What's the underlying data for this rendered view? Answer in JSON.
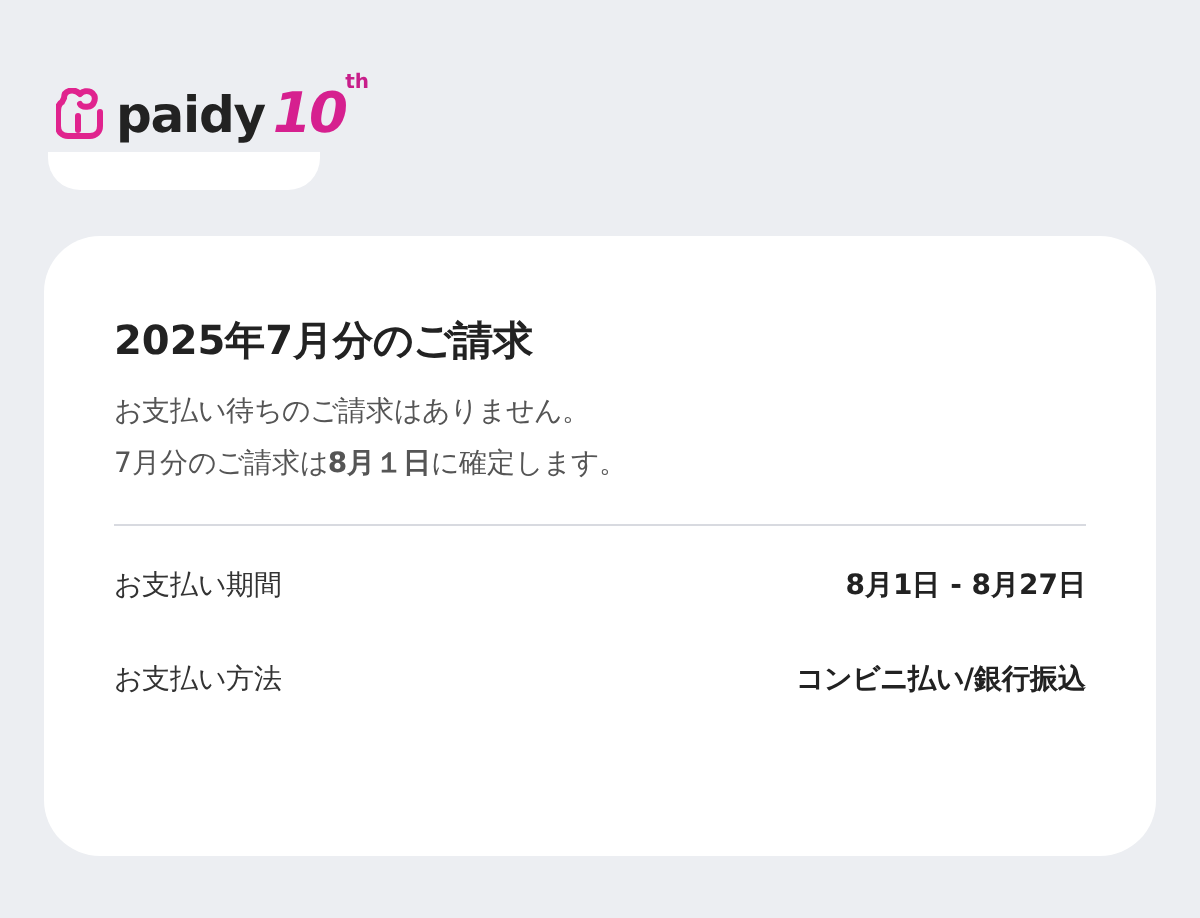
{
  "logo": {
    "brand": "paidy",
    "anniversary": "10",
    "suffix": "th"
  },
  "bill": {
    "title": "2025年7月分のご請求",
    "messages": [
      "お支払い待ちのご請求はありません。",
      "7月分のご請求は**8月１日**に確定します。"
    ],
    "rows": [
      {
        "label": "お支払い期間",
        "value": "8月1日 - 8月27日"
      },
      {
        "label": "お支払い方法",
        "value": "コンビニ払い/銀行振込"
      }
    ]
  }
}
